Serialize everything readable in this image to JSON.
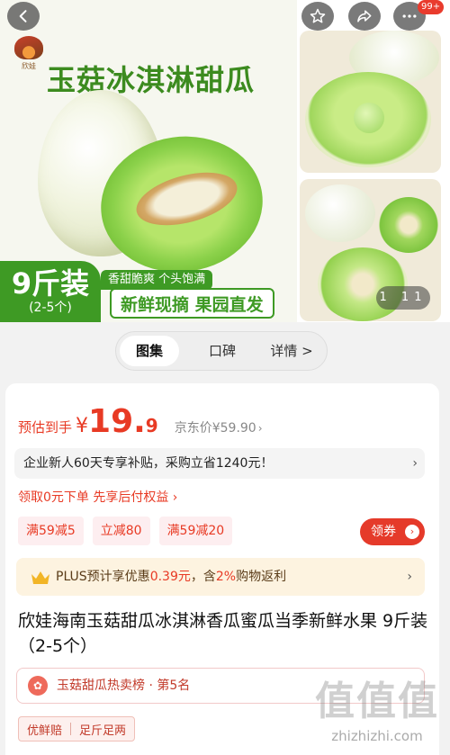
{
  "gallery": {
    "hero_title": "玉菇冰淇淋甜瓜",
    "brand_text": "欣娃",
    "weight_big": "9斤装",
    "weight_small": "(2-5个)",
    "tag_sweet": "香甜脆爽 个头饱满",
    "tag_fresh": "新鲜现摘 果园直发",
    "counter": "1 11",
    "notification_count": "99+"
  },
  "tabs": [
    {
      "label": "图集",
      "active": true
    },
    {
      "label": "口碑",
      "active": false
    },
    {
      "label": "详情 >",
      "active": false
    }
  ],
  "price": {
    "label": "预估到手",
    "currency": "¥",
    "integer": "19.",
    "decimal": "9",
    "jd_price": "京东价¥59.90",
    "jd_arrow": "›"
  },
  "subsidy": {
    "text": "企业新人60天专享补贴，采购立省1240元！",
    "chevron": "›"
  },
  "credit": {
    "text": "领取0元下单 先享后付权益 ›"
  },
  "coupons": [
    "满59减5",
    "立减80",
    "满59减20"
  ],
  "get_coupon": {
    "label": "领券",
    "arrow": "›"
  },
  "plus": {
    "prefix": "PLUS预计享优惠",
    "amount": "0.39元",
    "middle": "，含",
    "rate": "2%",
    "suffix": "购物返利",
    "chevron": "›"
  },
  "product_title": "欣娃海南玉菇甜瓜冰淇淋香瓜蜜瓜当季新鲜水果 9斤装（2-5个）",
  "rank": {
    "icon_text": "✿",
    "text": "玉菇甜瓜热卖榜 · 第5名"
  },
  "guarantee": [
    "优鲜赔",
    "足斤足两"
  ],
  "watermark": {
    "big": "值值值",
    "small": "zhizhizhi.com"
  },
  "colors": {
    "accent_red": "#e83a24",
    "brand_green": "#3e9a24",
    "plus_bg": "#fdf3e0"
  }
}
